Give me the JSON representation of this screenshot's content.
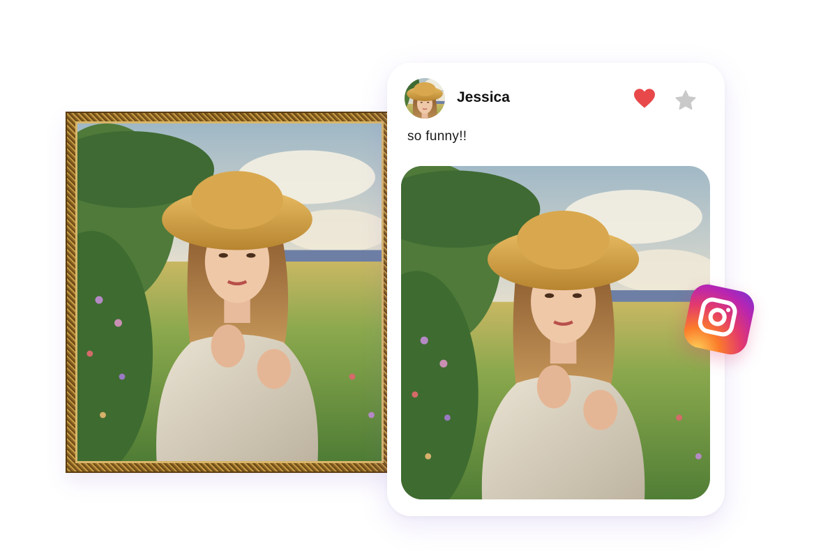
{
  "post": {
    "user_name": "Jessica",
    "caption": "so funny!!",
    "liked": true,
    "starred": false
  },
  "icons": {
    "like": "heart-icon",
    "star": "star-icon",
    "brand": "instagram-icon"
  },
  "colors": {
    "heart": "#e8484a",
    "star": "#c9c9c9",
    "frame_gold": "#c79a45",
    "card_shadow": "#8264dc"
  }
}
